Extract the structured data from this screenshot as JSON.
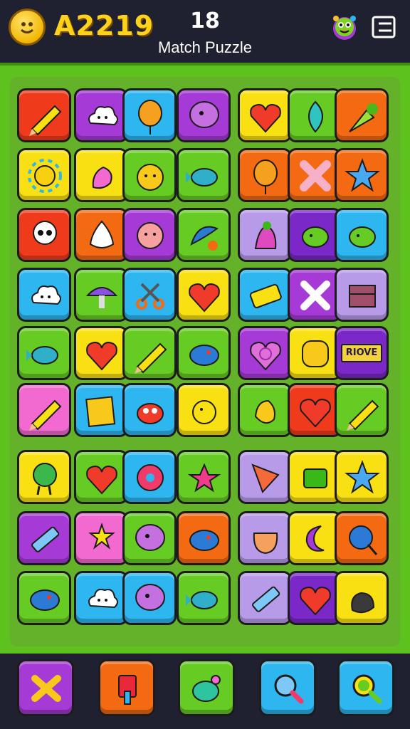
{
  "header": {
    "coins": "A2219",
    "level": "18",
    "title": "Match Puzzle"
  },
  "colors": {
    "red": "#f03a1c",
    "purple": "#a53ad6",
    "blue": "#2db6f0",
    "yellow": "#f8e012",
    "green": "#66cc24",
    "orange": "#f46a12",
    "pink": "#f26ad0",
    "lavender": "#b79ae8",
    "deep_purple": "#7a28c8"
  },
  "board": {
    "rows": [
      [
        "red:pencil",
        "purple:cloud",
        "blue:balloon",
        "purple:bubble",
        "yellow:heart",
        "green:leaf",
        "orange:carrot"
      ],
      [
        "yellow:sun",
        "yellow:pink-creature",
        "green:sun-face",
        "green:fish",
        "orange:balloon",
        "orange:pink-x",
        "orange:star"
      ],
      [
        "red:skull",
        "orange:ghost",
        "purple:face",
        "green:leaves",
        "lavender:squid",
        "deep_purple:blob",
        "blue:blob"
      ],
      [
        "blue:cloud",
        "green:mushroom",
        "blue:scissors",
        "yellow:heart",
        "blue:eraser",
        "purple:x",
        "lavender:box"
      ],
      [
        "green:fish",
        "yellow:heart",
        "green:pencil",
        "green:lemon",
        "purple:spiral-heart",
        "yellow:circle",
        "deep_purple:text"
      ],
      [
        "pink:pencil",
        "blue:dice",
        "blue:crab",
        "yellow:chick",
        "green:acorn",
        "red:heart",
        "green:pencil"
      ],
      [
        "yellow:turtle",
        "green:heart",
        "blue:donut",
        "green:flower",
        "lavender:cone",
        "yellow:cube",
        "yellow:star"
      ],
      [
        "purple:crayon",
        "pink:star-wand",
        "green:bubble",
        "orange:lemon",
        "lavender:pot",
        "yellow:moon",
        "orange:lollipop"
      ],
      [
        "green:lemon",
        "blue:cloud",
        "blue:bubble",
        "green:fish",
        "lavender:crayon",
        "deep_purple:heart",
        "yellow:sack"
      ]
    ],
    "special_text": "RIOVE"
  },
  "toolbar": {
    "tools": [
      {
        "name": "shuffle-tool",
        "color": "purple",
        "icon": "cross-icon"
      },
      {
        "name": "hammer-tool",
        "color": "orange",
        "icon": "hammer-icon"
      },
      {
        "name": "bomb-tool",
        "color": "green",
        "icon": "bomb-icon"
      },
      {
        "name": "magnifier-tool",
        "color": "blue",
        "icon": "magnifier-icon"
      },
      {
        "name": "hint-tool",
        "color": "blue",
        "icon": "search-icon"
      }
    ]
  }
}
